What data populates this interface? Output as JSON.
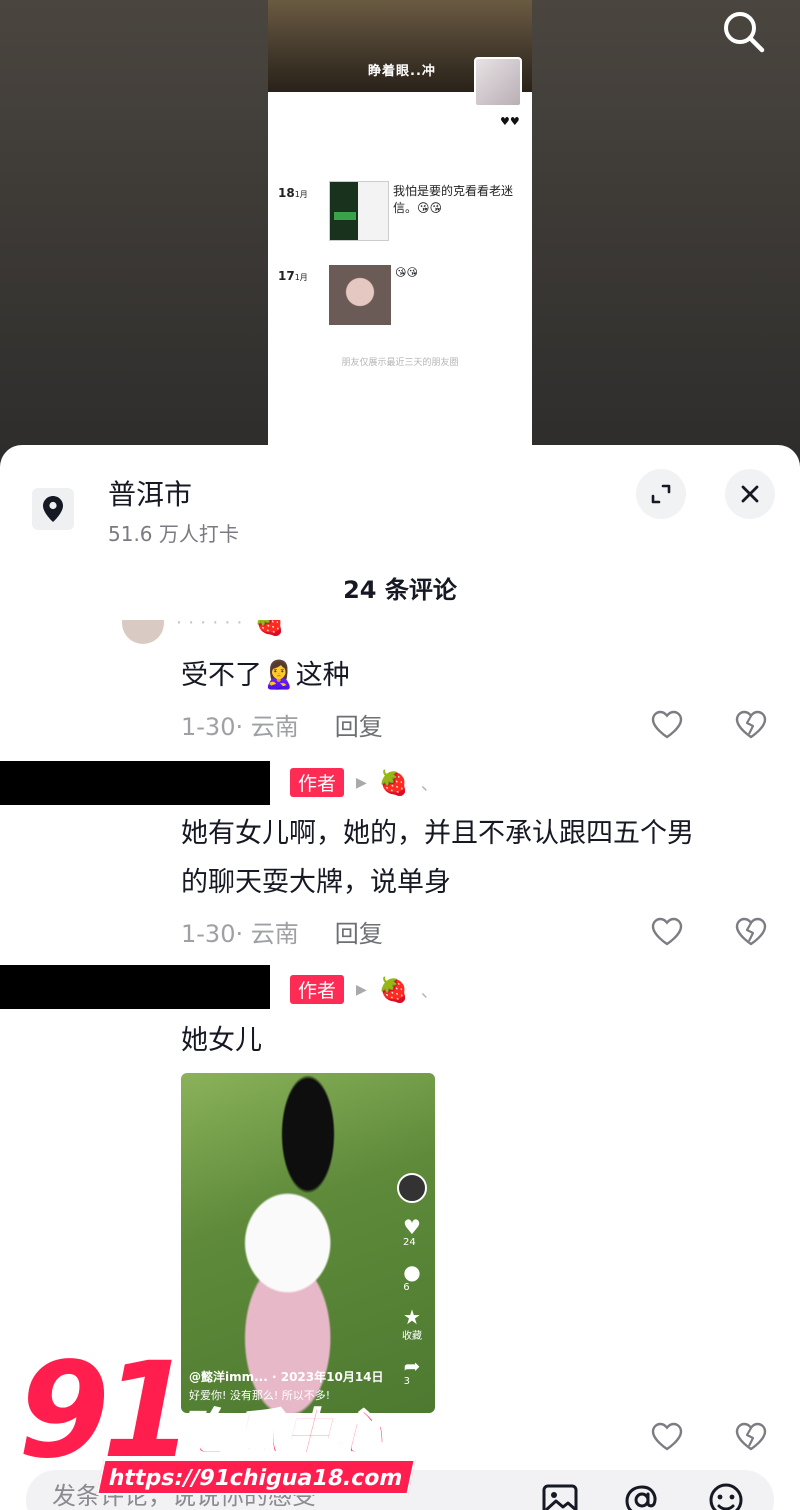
{
  "screenshot": {
    "caption": "睁着眼..冲",
    "hearts": "♥♥",
    "posts": [
      {
        "day": "18",
        "month": "1月",
        "text": "我怕是要的克看看老迷信。😘😘"
      },
      {
        "day": "17",
        "month": "1月",
        "text": "😘😘"
      }
    ],
    "footer": "朋友仅展示最近三天的朋友圈"
  },
  "location": {
    "name": "普洱市",
    "checkins": "51.6 万人打卡"
  },
  "comments_header": {
    "count_label": "24 条评论"
  },
  "comments": [
    {
      "author_tag": "",
      "text_lines": [
        "受不了🙎‍♀️这种"
      ],
      "time": "1-30· 云南",
      "reply": "回复"
    },
    {
      "author_tag": "作者",
      "text_lines": [
        "她有女儿啊，她的，并且不承认跟四五个男",
        "的聊天耍大牌，说单身"
      ],
      "time": "1-30· 云南",
      "reply": "回复"
    },
    {
      "author_tag": "作者",
      "text_lines": [
        "她女儿"
      ],
      "time": "",
      "reply": ""
    }
  ],
  "image": {
    "user": "@懿洋imm...",
    "date": "2023年10月14日",
    "caption": "好爱你! 没有那么! 所以不多!",
    "likes": "24",
    "comments": "6",
    "favorite_label": "收藏",
    "shares": "3"
  },
  "input": {
    "placeholder": "发条评论，说说你的感受"
  },
  "watermark": {
    "number": "91",
    "name": "吃瓜中心",
    "url": "https://91chigua18.com"
  }
}
